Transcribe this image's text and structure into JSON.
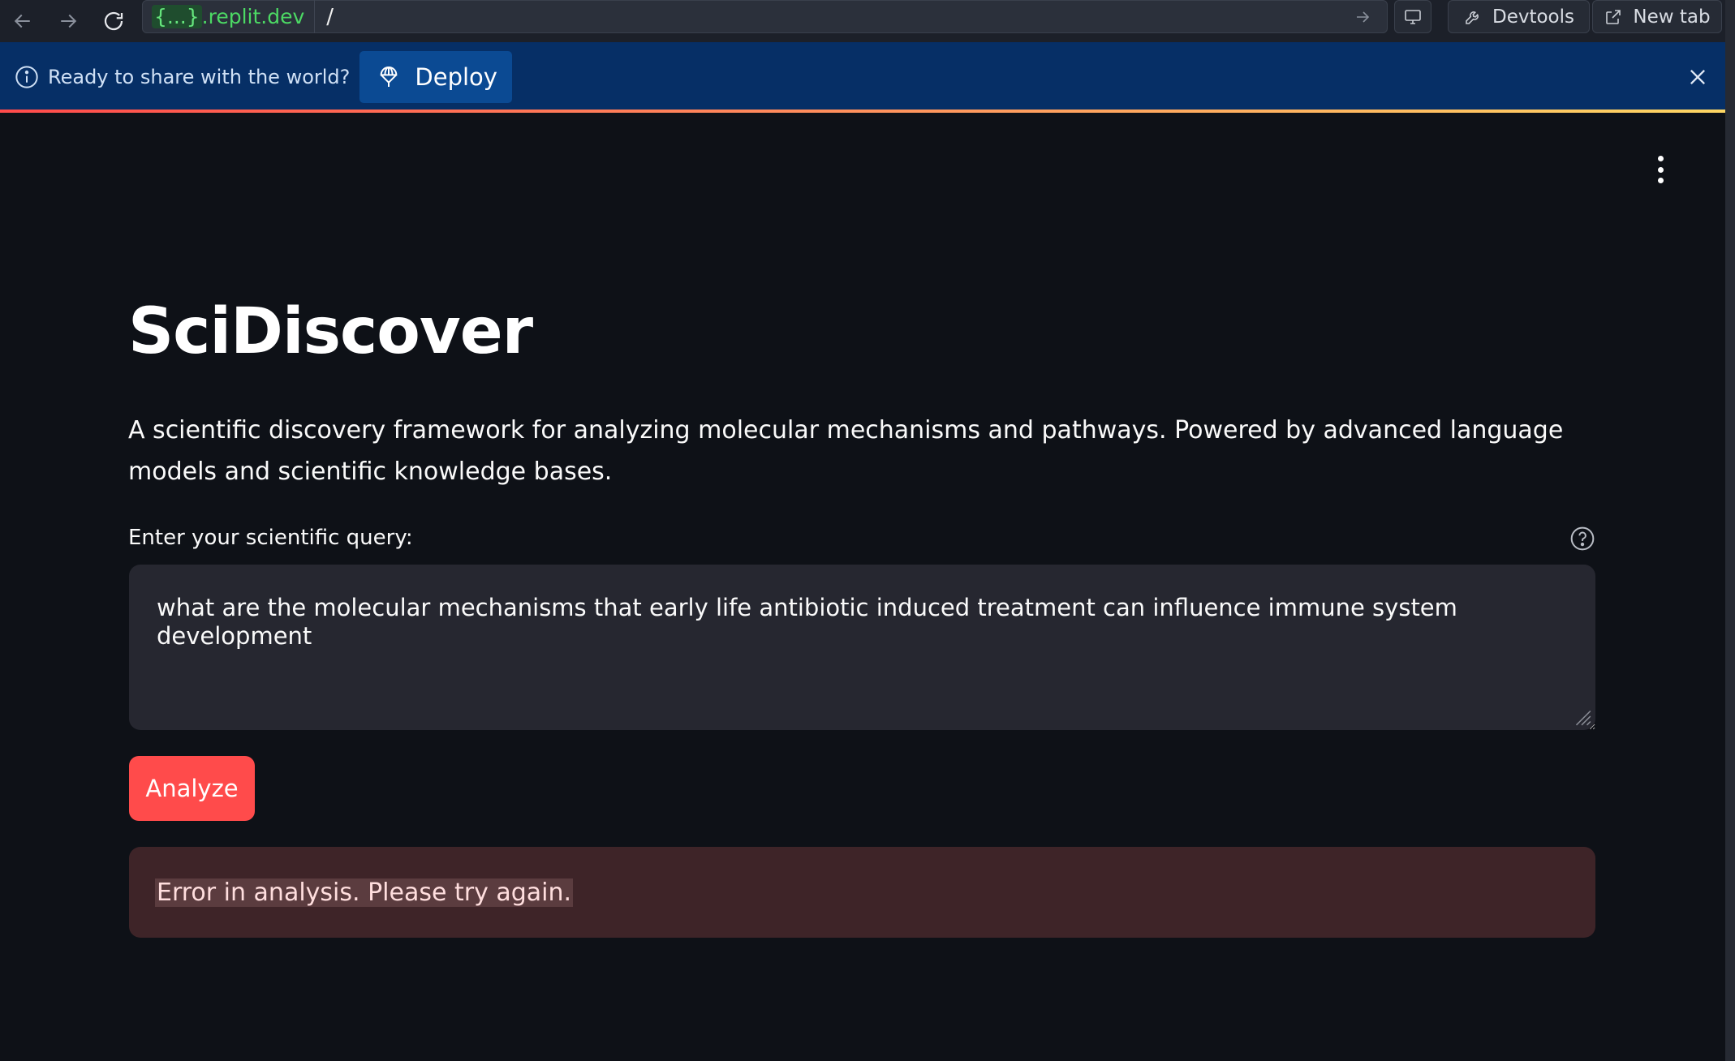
{
  "browser": {
    "url_host_brace": "{...}",
    "url_host_rest": ".replit.dev",
    "url_path": "/",
    "devtools_label": "Devtools",
    "new_tab_label": "New tab"
  },
  "banner": {
    "message": "Ready to share with the world?",
    "deploy_label": "Deploy"
  },
  "app": {
    "title": "SciDiscover",
    "description": "A scientific discovery framework for analyzing molecular mechanisms and pathways. Powered by advanced language models and scientific knowledge bases.",
    "query_label": "Enter your scientific query:",
    "query_value": "what are the molecular mechanisms that early life antibiotic induced treatment can influence immune system development",
    "analyze_label": "Analyze",
    "error_message": "Error in analysis. Please try again."
  },
  "colors": {
    "background": "#0e1117",
    "accent": "#ff4b4b",
    "banner": "#062f66",
    "error_bg": "#3e2428"
  },
  "icons": [
    "back-arrow-icon",
    "forward-arrow-icon",
    "reload-icon",
    "go-arrow-icon",
    "monitor-icon",
    "wrench-icon",
    "external-link-icon",
    "info-icon",
    "deploy-icon",
    "close-icon",
    "kebab-menu-icon",
    "help-icon",
    "resize-grip-icon"
  ]
}
